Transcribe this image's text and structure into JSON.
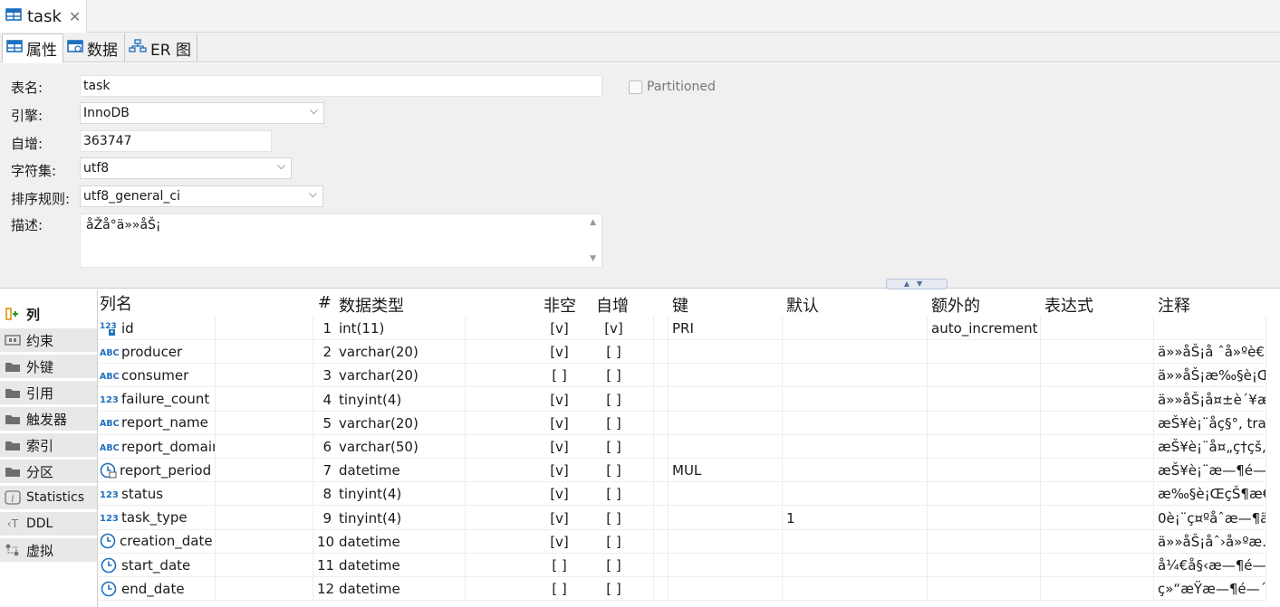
{
  "tab": {
    "title": "task"
  },
  "subtabs": [
    {
      "label": "属性",
      "icon": "table-icon"
    },
    {
      "label": "数据",
      "icon": "data-grid-icon"
    },
    {
      "label": "ER 图",
      "icon": "er-diagram-icon"
    }
  ],
  "form": {
    "table_name_label": "表名:",
    "table_name": "task",
    "partitioned_label": "Partitioned",
    "engine_label": "引擎:",
    "engine": "InnoDB",
    "auto_inc_label": "自增:",
    "auto_inc": "363747",
    "charset_label": "字符集:",
    "charset": "utf8",
    "collation_label": "排序规则:",
    "collation": "utf8_general_ci",
    "desc_label": "描述:",
    "desc": "åŽå°ä»»åŠ¡"
  },
  "nav": [
    {
      "label": "列",
      "icon": "column-add-icon"
    },
    {
      "label": "约束",
      "icon": "constraint-icon"
    },
    {
      "label": "外键",
      "icon": "folder-icon"
    },
    {
      "label": "引用",
      "icon": "folder-icon"
    },
    {
      "label": "触发器",
      "icon": "folder-icon"
    },
    {
      "label": "索引",
      "icon": "folder-icon"
    },
    {
      "label": "分区",
      "icon": "folder-icon"
    },
    {
      "label": "Statistics",
      "icon": "info-icon"
    },
    {
      "label": "DDL",
      "icon": "ddl-icon"
    },
    {
      "label": "虚拟",
      "icon": "virtual-icon"
    }
  ],
  "columns_header": {
    "name": "列名",
    "num": "#",
    "type": "数据类型",
    "not_null": "非空",
    "auto_inc": "自增",
    "key": "键",
    "default": "默认",
    "extra": "额外的",
    "expr": "表达式",
    "comment": "注释"
  },
  "rows": [
    {
      "icon": "key-number-icon",
      "name": "id",
      "num": "1",
      "type": "int(11)",
      "nn": "[v]",
      "ai": "[v]",
      "key": "PRI",
      "def": "",
      "extra": "auto_increment",
      "expr": "",
      "comment": ""
    },
    {
      "icon": "string-type-icon",
      "name": "producer",
      "num": "2",
      "type": "varchar(20)",
      "nn": "[v]",
      "ai": "[ ]",
      "key": "",
      "def": "",
      "extra": "",
      "expr": "",
      "comment": "ä»»åŠ¡å ˆå»ºè€…"
    },
    {
      "icon": "string-type-icon",
      "name": "consumer",
      "num": "3",
      "type": "varchar(20)",
      "nn": "[ ]",
      "ai": "[ ]",
      "key": "",
      "def": "",
      "extra": "",
      "expr": "",
      "comment": "ä»»åŠ¡æ‰§è¡Œ…"
    },
    {
      "icon": "number-type-icon",
      "name": "failure_count",
      "num": "4",
      "type": "tinyint(4)",
      "nn": "[v]",
      "ai": "[ ]",
      "key": "",
      "def": "",
      "extra": "",
      "expr": "",
      "comment": "ä»»åŠ¡å¤±è´¥æ…"
    },
    {
      "icon": "string-type-icon",
      "name": "report_name",
      "num": "5",
      "type": "varchar(20)",
      "nn": "[v]",
      "ai": "[ ]",
      "key": "",
      "def": "",
      "extra": "",
      "expr": "",
      "comment": "æŠ¥è¡¨åç§°, tra…"
    },
    {
      "icon": "string-type-icon",
      "name": "report_domain",
      "num": "6",
      "type": "varchar(50)",
      "nn": "[v]",
      "ai": "[ ]",
      "key": "",
      "def": "",
      "extra": "",
      "expr": "",
      "comment": "æŠ¥è¡¨å¤„ç†çš„…"
    },
    {
      "icon": "datetime-index-icon",
      "name": "report_period",
      "num": "7",
      "type": "datetime",
      "nn": "[v]",
      "ai": "[ ]",
      "key": "MUL",
      "def": "",
      "extra": "",
      "expr": "",
      "comment": "æŠ¥è¡¨æ—¶é—´"
    },
    {
      "icon": "number-type-icon",
      "name": "status",
      "num": "8",
      "type": "tinyint(4)",
      "nn": "[v]",
      "ai": "[ ]",
      "key": "",
      "def": "",
      "extra": "",
      "expr": "",
      "comment": "æ‰§è¡ŒçŠ¶æ€…"
    },
    {
      "icon": "number-type-icon",
      "name": "task_type",
      "num": "9",
      "type": "tinyint(4)",
      "nn": "[v]",
      "ai": "[ ]",
      "key": "",
      "def": "1",
      "extra": "",
      "expr": "",
      "comment": "0è¡¨ç¤ºåˆæ—¶ä…"
    },
    {
      "icon": "datetime-icon",
      "name": "creation_date",
      "num": "10",
      "type": "datetime",
      "nn": "[v]",
      "ai": "[ ]",
      "key": "",
      "def": "",
      "extra": "",
      "expr": "",
      "comment": "ä»»åŠ¡åˆ›å»ºæ…"
    },
    {
      "icon": "datetime-icon",
      "name": "start_date",
      "num": "11",
      "type": "datetime",
      "nn": "[ ]",
      "ai": "[ ]",
      "key": "",
      "def": "",
      "extra": "",
      "expr": "",
      "comment": "å¼€å§‹æ—¶é—´…"
    },
    {
      "icon": "datetime-icon",
      "name": "end_date",
      "num": "12",
      "type": "datetime",
      "nn": "[ ]",
      "ai": "[ ]",
      "key": "",
      "def": "",
      "extra": "",
      "expr": "",
      "comment": "ç»“æŸæ—¶é—´,…"
    }
  ]
}
